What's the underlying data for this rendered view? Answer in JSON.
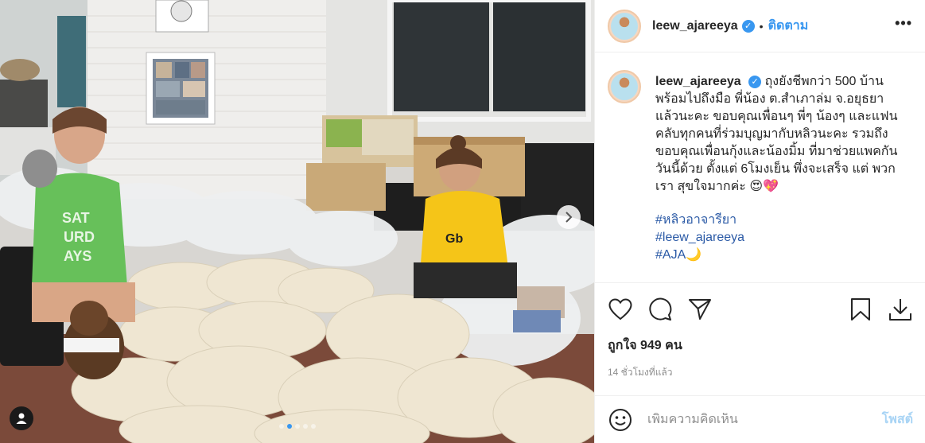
{
  "post": {
    "username": "leew_ajareeya",
    "follow_label": "ติดตาม",
    "separator": "•",
    "more_label": "•••",
    "caption": {
      "username": "leew_ajareeya",
      "text": "ถุงยังชีพกว่า 500 บ้าน พร้อมไปถึงมือ พี่น้อง ต.สำเภาล่ม จ.อยุธยา แล้วนะคะ ขอบคุณเพื่อนๆ พี่ๆ น้องๆ และแฟนคลับทุกคนที่ร่วมบุญมากับหลิวนะคะ รวมถึงขอบคุณเพื่อนกุ้งและน้องมิ้ม ที่มาช่วยแพคกันวันนี้ด้วย ตั้งแต่ 6โมงเย็น พึ่งจะเสร็จ แต่ พวกเรา สุขใจมากค่ะ 😍💖",
      "hashtags": [
        "#หลิวอาจารียา",
        "#leew_ajareeya",
        "#AJA🌙"
      ]
    },
    "likes_label": "ถูกใจ 949 คน",
    "time_label": "14 ชั่วโมงที่แล้ว",
    "comment_placeholder": "เพิ่มความคิดเห็น",
    "post_label": "โพสต์",
    "carousel": {
      "count": 5,
      "active_index": 1
    }
  },
  "icons": {
    "verified": "verified-badge-icon",
    "like": "heart-icon",
    "comment": "comment-bubble-icon",
    "share": "paper-plane-icon",
    "save": "bookmark-icon",
    "download": "download-icon",
    "emoji": "smiley-icon",
    "user_tags": "user-tag-icon",
    "next": "chevron-right-icon"
  },
  "colors": {
    "link": "#3897f0",
    "hashtag": "#2b5aa6",
    "post_disabled": "#a8d4f5"
  }
}
